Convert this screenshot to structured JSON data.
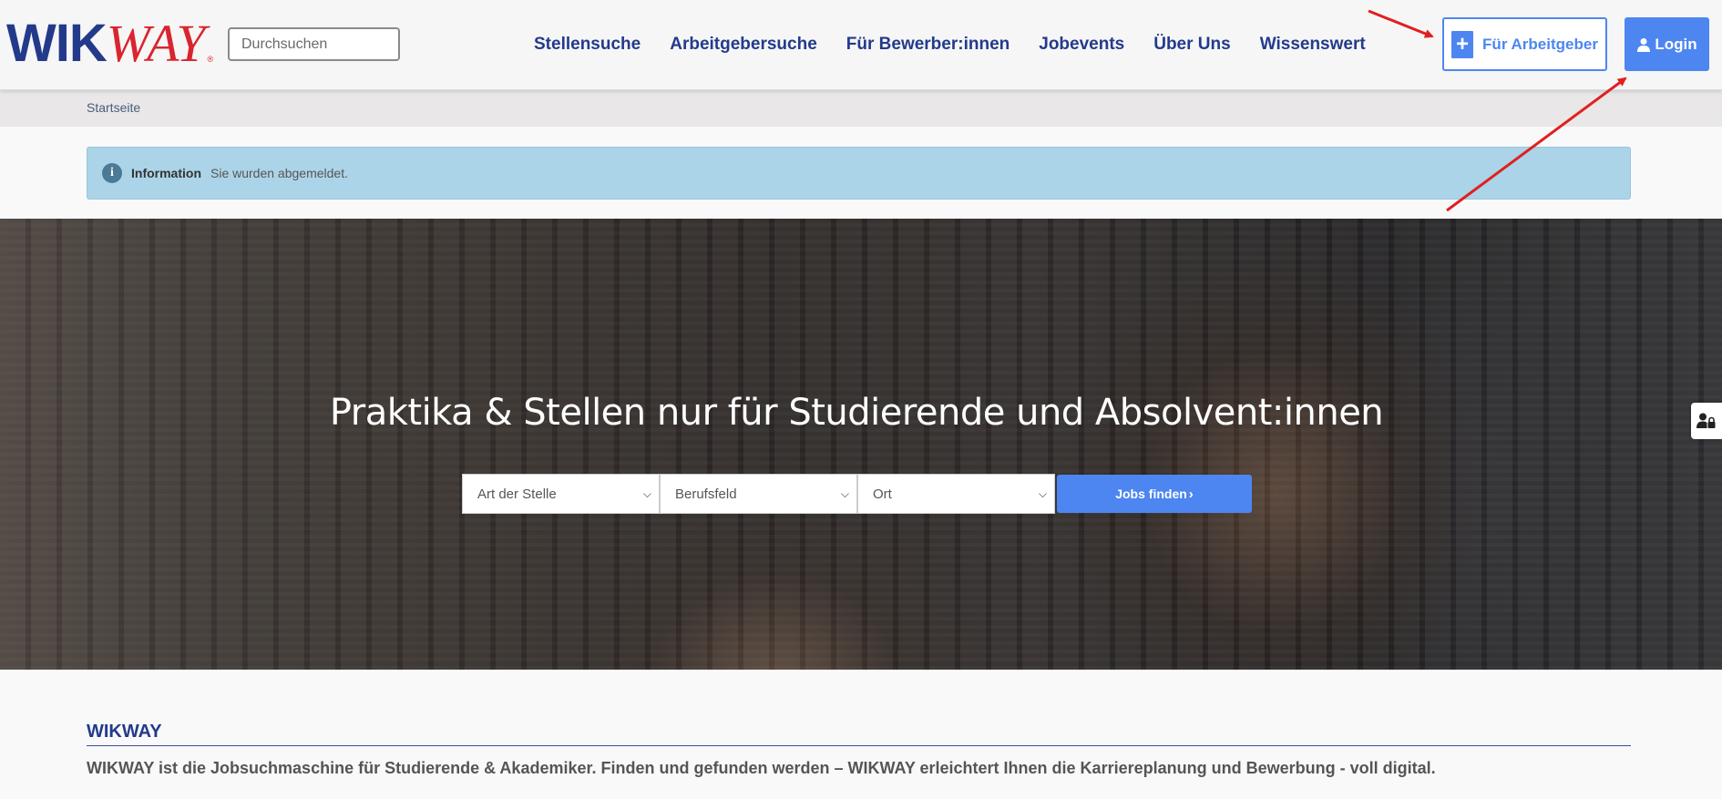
{
  "brand": {
    "logo_part1": "WIK",
    "logo_part2": "WAY",
    "logo_mark": "®"
  },
  "search": {
    "placeholder": "Durchsuchen"
  },
  "nav": {
    "items": [
      {
        "label": "Stellensuche"
      },
      {
        "label": "Arbeitgebersuche"
      },
      {
        "label": "Für Bewerber:innen"
      },
      {
        "label": "Jobevents"
      },
      {
        "label": "Über Uns"
      },
      {
        "label": "Wissenswert"
      }
    ]
  },
  "header_buttons": {
    "employer_label": "Für Arbeitgeber",
    "employer_icon": "plus-icon",
    "login_label": "Login",
    "login_icon": "user-icon"
  },
  "breadcrumb": {
    "home": "Startseite"
  },
  "alert": {
    "icon": "info-icon",
    "title": "Information",
    "message": "Sie wurden abgemeldet."
  },
  "hero": {
    "title": "Praktika & Stellen nur für Studierende und Absolvent:innen",
    "filters": [
      {
        "selected": "Art der Stelle"
      },
      {
        "selected": "Berufsfeld"
      },
      {
        "selected": "Ort"
      }
    ],
    "submit_label": "Jobs finden",
    "submit_icon": "chevron-right-icon"
  },
  "side_tab": {
    "icon": "user-lock-icon"
  },
  "about": {
    "heading": "WIKWAY",
    "text": "WIKWAY ist die Jobsuchmaschine für Studierende & Akademiker. Finden und gefunden werden – WIKWAY erleichtert Ihnen die Karriereplanung und Bewerbung - voll digital."
  },
  "colors": {
    "brand_blue": "#233a8b",
    "brand_red": "#d9252f",
    "accent_blue": "#4d86f0",
    "alert_bg": "#acd4e8",
    "annotation_arrow": "#e02020"
  }
}
